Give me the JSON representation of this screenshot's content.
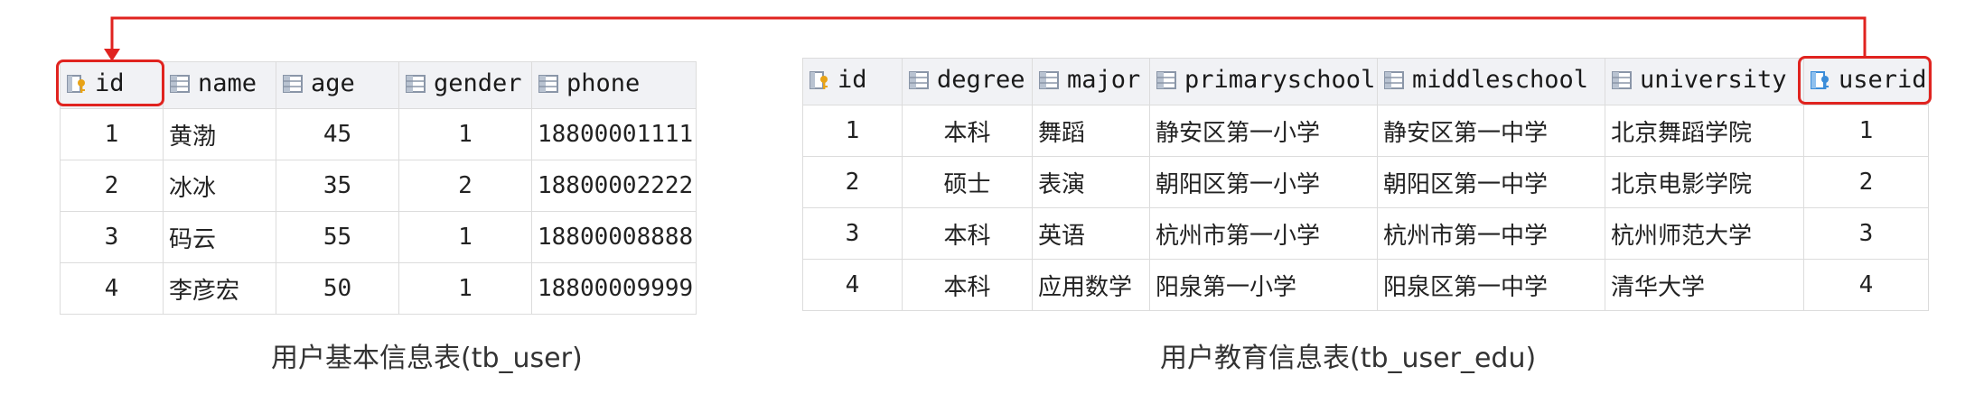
{
  "colors": {
    "highlight": "#e0231f",
    "header_bg": "#f1f2f5",
    "border": "#dcdcdc"
  },
  "icons": {
    "column": "column-icon",
    "primary_key": "primary-key-icon",
    "foreign_key": "foreign-key-icon"
  },
  "tb_user": {
    "caption": "用户基本信息表(tb_user)",
    "columns": [
      "id",
      "name",
      "age",
      "gender",
      "phone"
    ],
    "rows": [
      [
        "1",
        "黄渤",
        "45",
        "1",
        "18800001111"
      ],
      [
        "2",
        "冰冰",
        "35",
        "2",
        "18800002222"
      ],
      [
        "3",
        "码云",
        "55",
        "1",
        "18800008888"
      ],
      [
        "4",
        "李彦宏",
        "50",
        "1",
        "18800009999"
      ]
    ]
  },
  "tb_user_edu": {
    "caption": "用户教育信息表(tb_user_edu)",
    "columns": [
      "id",
      "degree",
      "major",
      "primaryschool",
      "middleschool",
      "university",
      "userid"
    ],
    "rows": [
      [
        "1",
        "本科",
        "舞蹈",
        "静安区第一小学",
        "静安区第一中学",
        "北京舞蹈学院",
        "1"
      ],
      [
        "2",
        "硕士",
        "表演",
        "朝阳区第一小学",
        "朝阳区第一中学",
        "北京电影学院",
        "2"
      ],
      [
        "3",
        "本科",
        "英语",
        "杭州市第一小学",
        "杭州市第一中学",
        "杭州师范大学",
        "3"
      ],
      [
        "4",
        "本科",
        "应用数学",
        "阳泉第一小学",
        "阳泉区第一中学",
        "清华大学",
        "4"
      ]
    ]
  }
}
